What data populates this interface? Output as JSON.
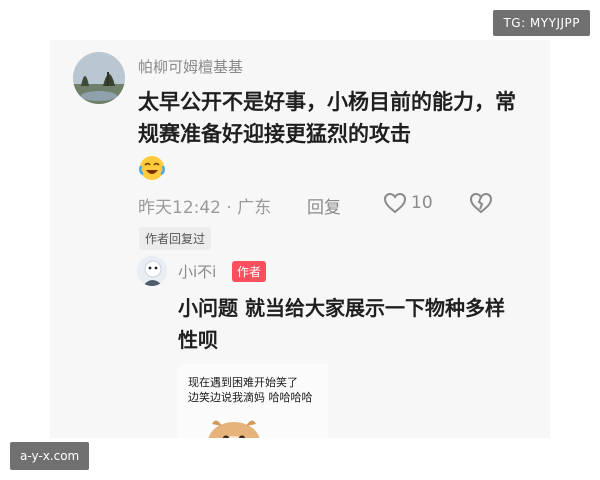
{
  "watermarks": {
    "top": "TG: MYYJJPP",
    "bottom": "a-y-x.com"
  },
  "comment": {
    "username": "帕柳可姆檀基基",
    "text": "太早公开不是好事，小杨目前的能力，常规赛准备好迎接更猛烈的攻击",
    "emoji": "crying-laughing-emoji",
    "meta": "昨天12:42 · 广东",
    "reply_label": "回复",
    "like_count": "10",
    "author_replied_label": "作者回复过"
  },
  "reply": {
    "username": "小i不i",
    "author_badge": "作者",
    "text": "小问题 就当给大家展示一下物种多样性呗",
    "meme_lines": [
      "现在遇到困难开始笑了",
      "边笑边说我滴妈 哈哈哈哈"
    ]
  },
  "colors": {
    "card_bg": "#f7f7f7",
    "author_badge": "#ff4e5e",
    "muted_text": "#8a8a8a",
    "watermark_bg": "#707070"
  }
}
